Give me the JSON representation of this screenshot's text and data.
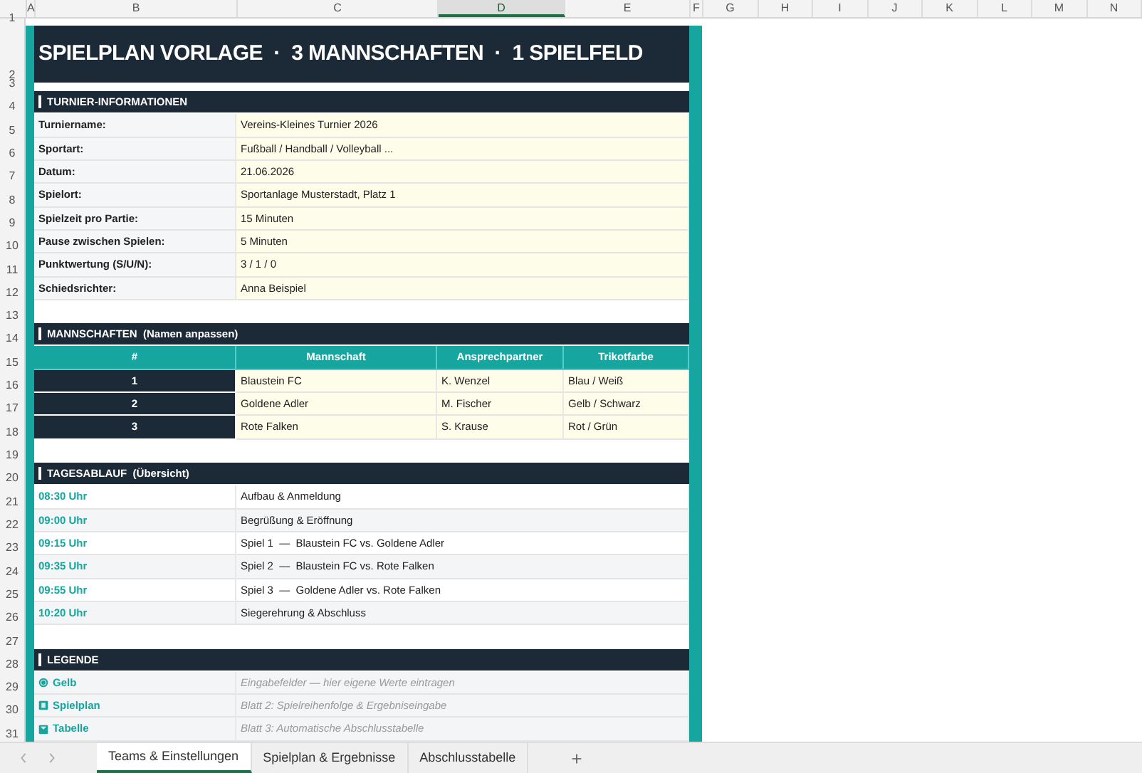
{
  "column_headers": [
    {
      "label": "A",
      "selected": false
    },
    {
      "label": "B",
      "selected": false
    },
    {
      "label": "C",
      "selected": false
    },
    {
      "label": "D",
      "selected": true
    },
    {
      "label": "E",
      "selected": false
    },
    {
      "label": "F",
      "selected": false
    },
    {
      "label": "G",
      "selected": false
    },
    {
      "label": "H",
      "selected": false
    },
    {
      "label": "I",
      "selected": false
    },
    {
      "label": "J",
      "selected": false
    },
    {
      "label": "K",
      "selected": false
    },
    {
      "label": "L",
      "selected": false
    },
    {
      "label": "M",
      "selected": false
    },
    {
      "label": "N",
      "selected": false
    }
  ],
  "row_numbers": [
    "1",
    "2",
    "3",
    "4",
    "5",
    "6",
    "7",
    "8",
    "9",
    "10",
    "11",
    "12",
    "13",
    "14",
    "15",
    "16",
    "17",
    "18",
    "19",
    "20",
    "21",
    "22",
    "23",
    "24",
    "25",
    "26",
    "27",
    "28",
    "29",
    "30",
    "31"
  ],
  "title": "SPIELPLAN VORLAGE  ·  3 MANNSCHAFTEN  ·  1 SPIELFELD",
  "tournament_info": {
    "heading": "TURNIER-INFORMATIONEN",
    "fields": [
      {
        "label": "Turniername:",
        "value": "Vereins-Kleines Turnier 2026"
      },
      {
        "label": "Sportart:",
        "value": "Fußball / Handball / Volleyball ..."
      },
      {
        "label": "Datum:",
        "value": "21.06.2026"
      },
      {
        "label": "Spielort:",
        "value": "Sportanlage Musterstadt, Platz 1"
      },
      {
        "label": "Spielzeit pro Partie:",
        "value": "15 Minuten"
      },
      {
        "label": "Pause zwischen Spielen:",
        "value": "5 Minuten"
      },
      {
        "label": "Punktwertung (S/U/N):",
        "value": "3 / 1 / 0"
      },
      {
        "label": "Schiedsrichter:",
        "value": "Anna Beispiel"
      }
    ]
  },
  "teams": {
    "heading": "MANNSCHAFTEN  (Namen anpassen)",
    "columns": [
      "#",
      "Mannschaft",
      "Ansprechpartner",
      "Trikotfarbe"
    ],
    "rows": [
      {
        "number": "1",
        "team": "Blaustein FC",
        "contact": "K. Wenzel",
        "jersey": "Blau / Weiß"
      },
      {
        "number": "2",
        "team": "Goldene Adler",
        "contact": "M. Fischer",
        "jersey": "Gelb / Schwarz"
      },
      {
        "number": "3",
        "team": "Rote Falken",
        "contact": "S. Krause",
        "jersey": "Rot / Grün"
      }
    ]
  },
  "schedule": {
    "heading": "TAGESABLAUF  (Übersicht)",
    "items": [
      {
        "time": "08:30 Uhr",
        "activity": "Aufbau & Anmeldung"
      },
      {
        "time": "09:00 Uhr",
        "activity": "Begrüßung & Eröffnung"
      },
      {
        "time": "09:15 Uhr",
        "activity": "Spiel 1  —  Blaustein FC vs. Goldene Adler"
      },
      {
        "time": "09:35 Uhr",
        "activity": "Spiel 2  —  Blaustein FC vs. Rote Falken"
      },
      {
        "time": "09:55 Uhr",
        "activity": "Spiel 3  —  Goldene Adler vs. Rote Falken"
      },
      {
        "time": "10:20 Uhr",
        "activity": "Siegerehrung & Abschluss"
      }
    ]
  },
  "legend": {
    "heading": "LEGENDE",
    "items": [
      {
        "kind": "circle",
        "label": "Gelb",
        "description": "Eingabefelder — hier eigene Werte eintragen"
      },
      {
        "kind": "sheet",
        "label": "Spielplan",
        "description": "Blatt 2: Spielreihenfolge & Ergebniseingabe"
      },
      {
        "kind": "table",
        "label": "Tabelle",
        "description": "Blatt 3: Automatische Abschlusstabelle"
      }
    ]
  },
  "sheet_tabs": [
    {
      "label": "Teams & Einstellungen",
      "selected": true
    },
    {
      "label": "Spielplan & Ergebnisse",
      "selected": false
    },
    {
      "label": "Abschlusstabelle",
      "selected": false
    }
  ]
}
